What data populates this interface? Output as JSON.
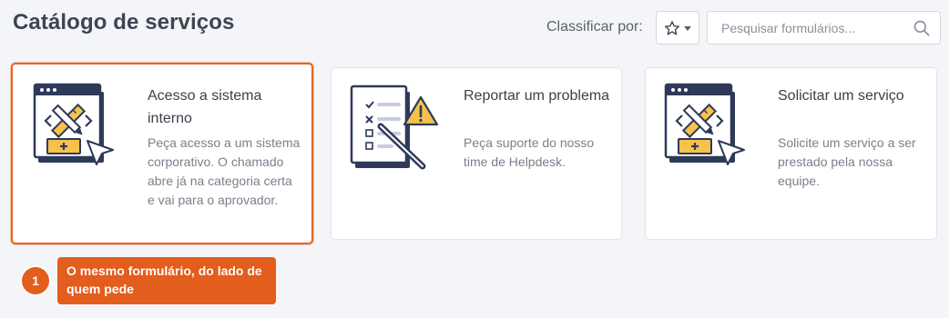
{
  "header": {
    "title": "Catálogo de serviços",
    "sort_label": "Classificar por:",
    "sort_icon": "star-icon",
    "search_placeholder": "Pesquisar formulários..."
  },
  "cards": [
    {
      "title": "Acesso a sistema interno",
      "description": "Peça acesso a um sistema corporativo. O chamado abre já na categoria certa e vai para o aprovador.",
      "icon": "code-tools-window-icon",
      "selected": true
    },
    {
      "title": "Reportar um problema",
      "description": "Peça suporte do nosso time de Helpdesk.",
      "icon": "checklist-warning-icon",
      "selected": false
    },
    {
      "title": "Solicitar um serviço",
      "description": "Solicite um serviço a ser prestado pela nossa equipe.",
      "icon": "code-tools-window-icon",
      "selected": false
    }
  ],
  "annotation": {
    "step": "1",
    "text": "O mesmo formulário, do lado de quem pede"
  },
  "colors": {
    "accent": "#e35d1c",
    "navy": "#333d5c",
    "illus_yellow": "#f5c24a"
  }
}
